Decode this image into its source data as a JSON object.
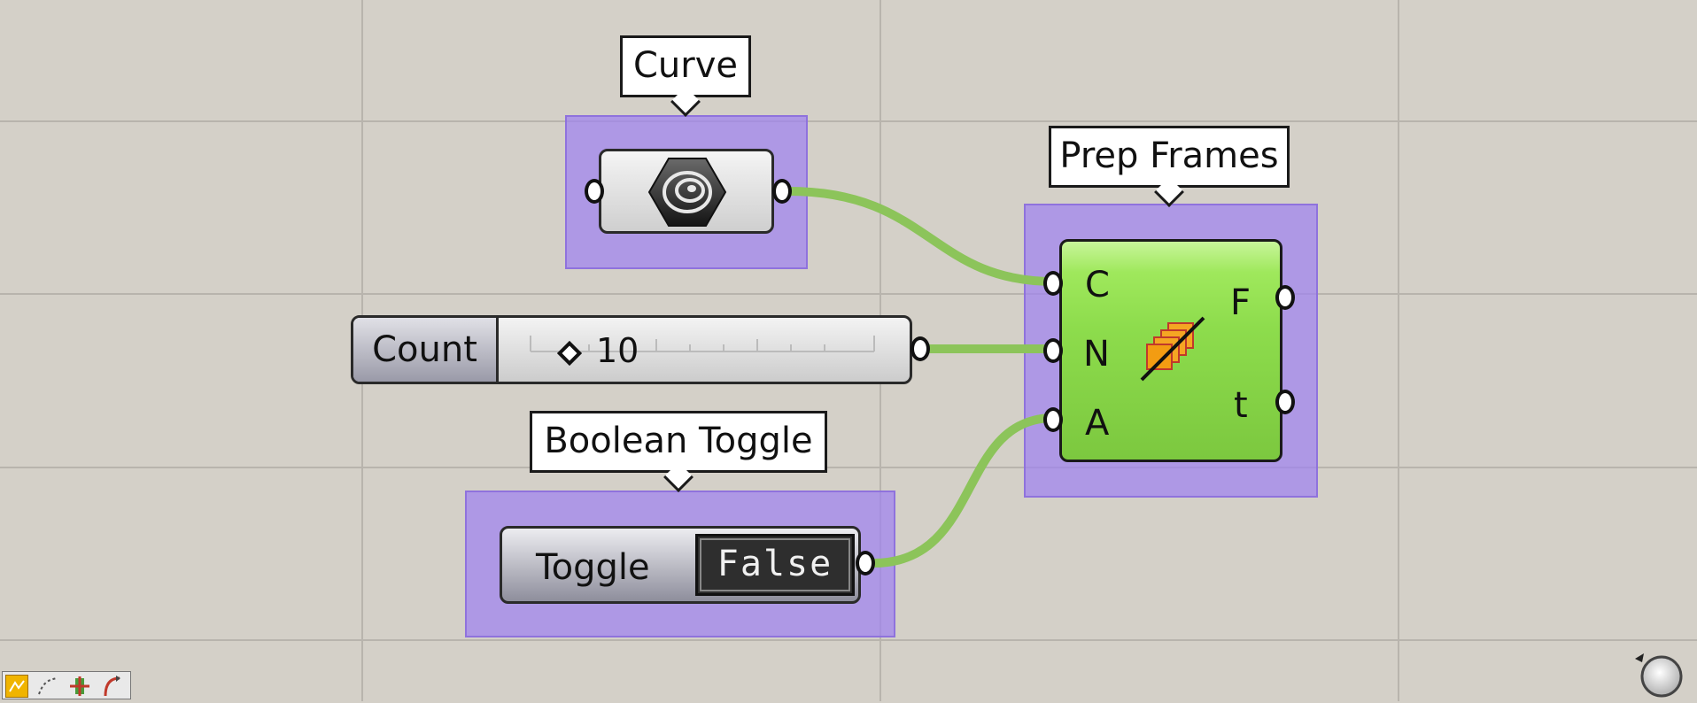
{
  "nodes": {
    "curve": {
      "tooltip": "Curve",
      "icon": "curve-param-icon"
    },
    "slider": {
      "label": "Count",
      "value": "10",
      "icon": "diamond-grip-icon"
    },
    "toggle": {
      "tooltip": "Boolean Toggle",
      "label": "Toggle",
      "value": "False"
    },
    "prep_frames": {
      "tooltip": "Prep Frames",
      "inputs": [
        "C",
        "N",
        "A"
      ],
      "outputs": [
        "F",
        "t"
      ],
      "icon": "frames-icon"
    }
  },
  "colors": {
    "canvas": "#d4d0c8",
    "group": "#a082f0",
    "component": "#8ddc4c",
    "wire": "#8cc45a"
  },
  "toolbar": {
    "icons": [
      "grasshopper-logo-icon",
      "points-icon",
      "move-icon",
      "curve-tool-icon"
    ]
  },
  "navigation": {
    "icon": "navigation-orb-icon"
  }
}
